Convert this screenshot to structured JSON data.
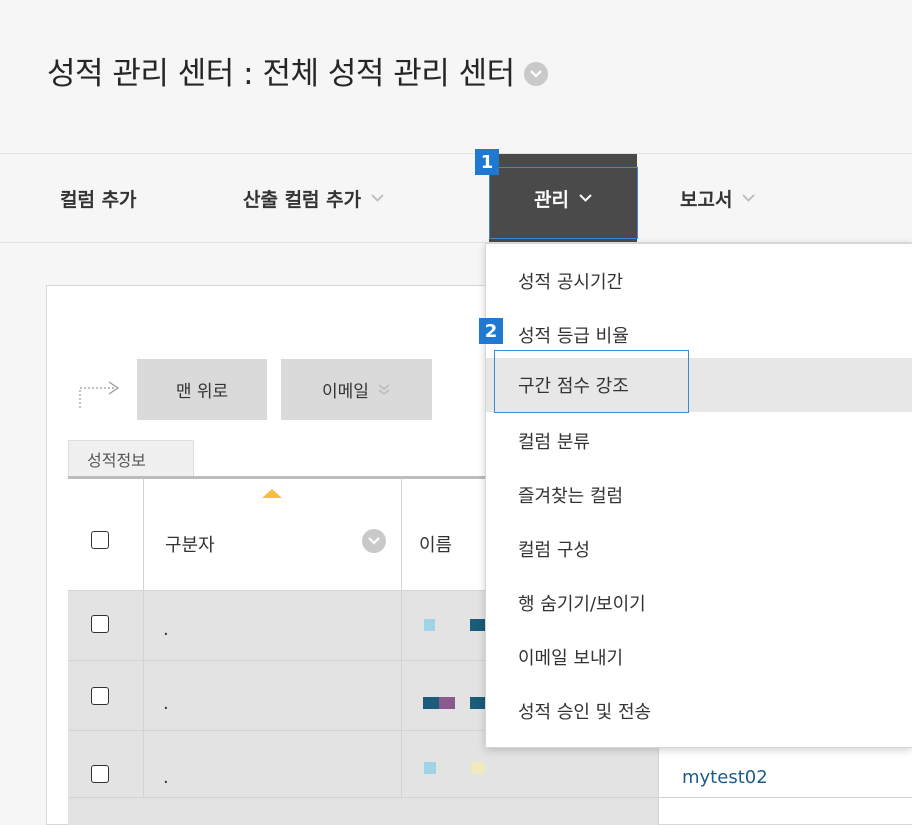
{
  "header": {
    "title": "성적 관리 센터 : 전체 성적 관리 센터"
  },
  "toolbar": {
    "add_column": "컬럼 추가",
    "add_calc_column": "산출 컬럼 추가",
    "manage": "관리",
    "reports": "보고서"
  },
  "badges": {
    "step1": "1",
    "step2": "2"
  },
  "actions": {
    "top": "맨 위로",
    "email": "이메일"
  },
  "table": {
    "tab_label": "성적정보",
    "headers": {
      "identifier": "구분자",
      "name": "이름"
    },
    "rows": [
      {
        "identifier": ".",
        "username": ""
      },
      {
        "identifier": ".",
        "username": ""
      },
      {
        "identifier": ".",
        "username": "mytest02"
      }
    ]
  },
  "manage_menu": {
    "items": [
      "성적 공시기간",
      "성적 등급 비율",
      "구간 점수 강조",
      "컬럼 분류",
      "즐겨찾는 컬럼",
      "컬럼 구성",
      "행 숨기기/보이기",
      "이메일 보내기",
      "성적 승인 및 전송"
    ]
  },
  "colors": {
    "highlight": "#3b8ad6",
    "badge": "#1f78d1",
    "manage_bg": "#4a4a4a",
    "sort_indicator": "#f5c044"
  },
  "icons": [
    "chevron-down-icon",
    "sort-asc-icon",
    "arrow-corner-icon",
    "double-chevron-down-icon"
  ]
}
